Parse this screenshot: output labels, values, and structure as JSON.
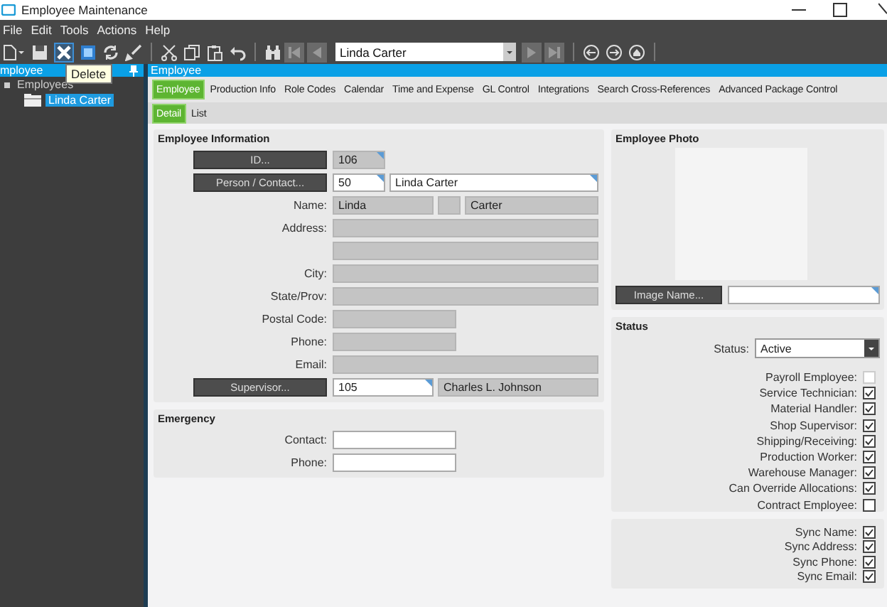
{
  "window": {
    "title": "Employee Maintenance"
  },
  "menu": [
    {
      "label": "File"
    },
    {
      "label": "Edit"
    },
    {
      "label": "Tools"
    },
    {
      "label": "Actions"
    },
    {
      "label": "Help"
    }
  ],
  "toolbar": {
    "search_value": "Linda Carter",
    "tooltip": "Delete"
  },
  "sidebar": {
    "title": "mployee",
    "tree": [
      {
        "label": "Employees",
        "expanded": true,
        "selected": false,
        "children": [
          {
            "label": "Linda Carter",
            "selected": true
          }
        ]
      }
    ]
  },
  "panel_title": "Employee",
  "tabs": [
    {
      "label": "Employee",
      "selected": true
    },
    {
      "label": "Production Info",
      "selected": false
    },
    {
      "label": "Role Codes",
      "selected": false
    },
    {
      "label": "Calendar",
      "selected": false
    },
    {
      "label": "Time and Expense",
      "selected": false
    },
    {
      "label": "GL Control",
      "selected": false
    },
    {
      "label": "Integrations",
      "selected": false
    },
    {
      "label": "Search Cross-References",
      "selected": false
    },
    {
      "label": "Advanced Package Control",
      "selected": false
    }
  ],
  "subtabs": [
    {
      "label": "Detail",
      "selected": true
    },
    {
      "label": "List",
      "selected": false
    }
  ],
  "employee_information": {
    "title": "Employee Information",
    "rows": [
      {
        "kind": "button",
        "label": "ID...",
        "fields": [
          {
            "kind": "narrow",
            "value": "106",
            "disabled": true,
            "lookup": true
          }
        ]
      },
      {
        "kind": "button",
        "label": "Person / Contact...",
        "fields": [
          {
            "kind": "narrow",
            "value": "50",
            "disabled": false,
            "lookup": true
          },
          {
            "kind": "wide",
            "value": "Linda Carter",
            "disabled": false,
            "lookup": true
          }
        ]
      },
      {
        "kind": "label",
        "label": "Name:",
        "fields": [
          {
            "kind": "short",
            "value": "Linda",
            "disabled": true,
            "lookup": false
          },
          {
            "kind": "tiny",
            "disabled": true,
            "lookup": false
          },
          {
            "kind": "wide",
            "value": "Carter",
            "disabled": true,
            "lookup": false
          }
        ]
      },
      {
        "kind": "label",
        "label": "Address:",
        "fields": [
          {
            "kind": "wide",
            "disabled": true,
            "lookup": false
          }
        ]
      },
      {
        "kind": "label",
        "fields": [
          {
            "kind": "wide",
            "disabled": true,
            "lookup": false
          }
        ]
      },
      {
        "kind": "label",
        "label": "City:",
        "fields": [
          {
            "kind": "wide",
            "disabled": true,
            "lookup": false
          }
        ]
      },
      {
        "kind": "label",
        "label": "State/Prov:",
        "fields": [
          {
            "kind": "wide",
            "disabled": true,
            "lookup": false
          }
        ]
      },
      {
        "kind": "label",
        "label": "Postal Code:",
        "fields": [
          {
            "kind": "medium",
            "disabled": true,
            "lookup": false
          }
        ]
      },
      {
        "kind": "label",
        "label": "Phone:",
        "fields": [
          {
            "kind": "medium",
            "disabled": true,
            "lookup": false
          }
        ]
      },
      {
        "kind": "label",
        "label": "Email:",
        "fields": [
          {
            "kind": "wide",
            "disabled": true,
            "lookup": false
          }
        ]
      },
      {
        "kind": "button",
        "label": "Supervisor...",
        "fields": [
          {
            "kind": "short",
            "value": "105",
            "disabled": false,
            "lookup": true
          },
          {
            "kind": "wide",
            "value": "Charles L. Johnson",
            "disabled": true,
            "lookup": false
          }
        ]
      }
    ]
  },
  "emergency": {
    "title": "Emergency",
    "rows": [
      {
        "kind": "label",
        "label": "Contact:",
        "fields": [
          {
            "kind": "medium",
            "disabled": false,
            "lookup": false
          }
        ]
      },
      {
        "kind": "label",
        "label": "Phone:",
        "fields": [
          {
            "kind": "medium",
            "disabled": false,
            "lookup": false
          }
        ]
      }
    ]
  },
  "photo": {
    "title": "Employee Photo",
    "button": "Image Name...",
    "field": {
      "disabled": false,
      "lookup": true
    }
  },
  "status": {
    "title": "Status",
    "label": "Status:",
    "value": "Active",
    "checkboxes": [
      {
        "label": "Payroll Employee:",
        "checked": false,
        "disabled": true
      },
      {
        "label": "Service Technician:",
        "checked": true,
        "disabled": false
      },
      {
        "label": "Material Handler:",
        "checked": true,
        "disabled": false
      },
      {
        "label": "Shop Supervisor:",
        "checked": true,
        "disabled": false
      },
      {
        "label": "Shipping/Receiving:",
        "checked": true,
        "disabled": false
      },
      {
        "label": "Production Worker:",
        "checked": true,
        "disabled": false
      },
      {
        "label": "Warehouse Manager:",
        "checked": true,
        "disabled": false
      },
      {
        "label": "Can Override Allocations:",
        "checked": true,
        "disabled": false
      },
      {
        "label": "Contract Employee:",
        "checked": false,
        "disabled": false
      }
    ]
  },
  "sync": {
    "checkboxes": [
      {
        "label": "Sync Name:",
        "checked": true,
        "disabled": false
      },
      {
        "label": "Sync Address:",
        "checked": true,
        "disabled": false
      },
      {
        "label": "Sync Phone:",
        "checked": true,
        "disabled": false
      },
      {
        "label": "Sync Email:",
        "checked": true,
        "disabled": false
      }
    ]
  }
}
